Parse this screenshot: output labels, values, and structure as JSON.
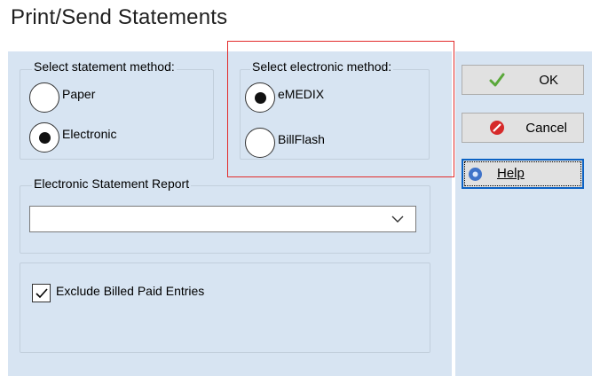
{
  "window": {
    "title": "Print/Send Statements"
  },
  "statement_method": {
    "label": "Select statement method:",
    "options": [
      {
        "label": "Paper",
        "selected": false
      },
      {
        "label": "Electronic",
        "selected": true
      }
    ]
  },
  "electronic_method": {
    "label": "Select electronic method:",
    "options": [
      {
        "label": "eMEDIX",
        "selected": true
      },
      {
        "label": "BillFlash",
        "selected": false
      }
    ]
  },
  "report": {
    "label": "Electronic Statement Report",
    "value": ""
  },
  "exclude": {
    "label": "Exclude Billed Paid Entries",
    "checked": true
  },
  "buttons": {
    "ok": "OK",
    "cancel": "Cancel",
    "help": "Help"
  },
  "colors": {
    "panel": "#d7e4f2",
    "highlight": "#e22b2b",
    "help_border": "#0b62c4"
  }
}
